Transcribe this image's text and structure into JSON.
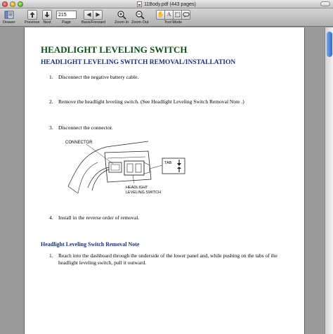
{
  "window": {
    "title": "11Body.pdf (443 pages)"
  },
  "toolbar": {
    "drawer": "Drawer",
    "previous": "Previous",
    "next": "Next",
    "page_label": "Page",
    "page_value": "215",
    "back_forward": "Back/Forward",
    "zoom_in": "Zoom In",
    "zoom_out": "Zoom Out",
    "tool_mode": "Tool Mode"
  },
  "document": {
    "title": "HEADLIGHT LEVELING SWITCH",
    "section": "HEADLIGHT LEVELING SWITCH REMOVAL/INSTALLATION",
    "steps": [
      {
        "num": "1.",
        "text": "Disconnect the negative battery cable."
      },
      {
        "num": "2.",
        "text": "Remove the headlight leveling switch. (See Headlight Leveling Switch Removal Note .)"
      },
      {
        "num": "3.",
        "text": "Disconnect the connector."
      },
      {
        "num": "4.",
        "text": "Install in the reverse order of removal."
      }
    ],
    "diagram": {
      "connector_label": "CONNECTOR",
      "tab_label": "TAB",
      "switch_label_1": "HEADLIGHT",
      "switch_label_2": "LEVELING SWITCH"
    },
    "note_heading": "Headlight Leveling Switch Removal Note",
    "note_step": {
      "num": "1.",
      "line1": "Reach into the dashboard through the underside of the lower panel and, while pushing on the tabs of the",
      "line2": "headlight leveling switch, pull it outward."
    }
  }
}
